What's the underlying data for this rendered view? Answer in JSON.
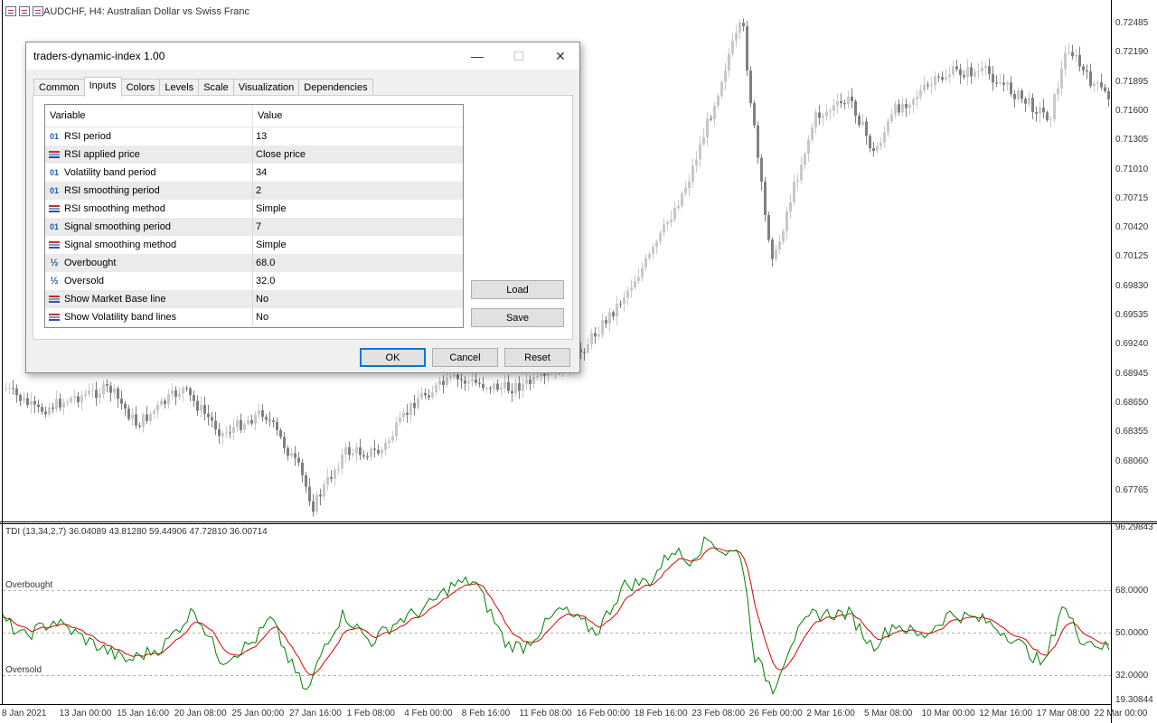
{
  "chart": {
    "title": "AUDCHF, H4:  Australian Dollar vs Swiss  Franc",
    "price_scale": [
      "0.72485",
      "0.72190",
      "0.71895",
      "0.71600",
      "0.71305",
      "0.71010",
      "0.70715",
      "0.70420",
      "0.70125",
      "0.69830",
      "0.69535",
      "0.69240",
      "0.68945",
      "0.68650",
      "0.68355",
      "0.68060",
      "0.67765"
    ],
    "indicator_scale": [
      "96.29843",
      "68.0000",
      "50.0000",
      "32.0000",
      "19.30844"
    ],
    "time_scale": [
      "8 Jan 2021",
      "13 Jan 00:00",
      "15 Jan 16:00",
      "20 Jan 08:00",
      "25 Jan 00:00",
      "27 Jan 16:00",
      "1 Feb 08:00",
      "4 Feb 00:00",
      "8 Feb 16:00",
      "11 Feb 08:00",
      "16 Feb 00:00",
      "18 Feb 16:00",
      "23 Feb 08:00",
      "26 Feb 00:00",
      "2 Mar 16:00",
      "5 Mar 08:00",
      "10 Mar 00:00",
      "12 Mar 16:00",
      "17 Mar 08:00",
      "22 Mar 00:00"
    ],
    "indicator_title": "TDI (13,34,2,7) 36.04089 43.81280 59.44906 47.72810 36.00714",
    "overbought_label": "Overbought",
    "oversold_label": "Oversold",
    "colors": {
      "fast_line": "#008000",
      "slow_line": "#e00000",
      "bull_candle": "#c8c8c8",
      "bear_candle": "#808080"
    }
  },
  "dialog": {
    "title": "traders-dynamic-index 1.00",
    "window_buttons": {
      "minimize": "—",
      "maximize": "☐",
      "close": "✕"
    },
    "tabs": [
      "Common",
      "Inputs",
      "Colors",
      "Levels",
      "Scale",
      "Visualization",
      "Dependencies"
    ],
    "active_tab": "Inputs",
    "grid": {
      "headers": [
        "Variable",
        "Value"
      ],
      "rows": [
        {
          "icon": "integer-icon",
          "icon_text": "01",
          "name": "RSI period",
          "value": "13"
        },
        {
          "icon": "enum-icon",
          "icon_text": "",
          "name": "RSI applied price",
          "value": "Close price"
        },
        {
          "icon": "integer-icon",
          "icon_text": "01",
          "name": "Volatility band period",
          "value": "34"
        },
        {
          "icon": "integer-icon",
          "icon_text": "01",
          "name": "RSI smoothing period",
          "value": "2"
        },
        {
          "icon": "enum-icon",
          "icon_text": "",
          "name": "RSI smoothing method",
          "value": "Simple"
        },
        {
          "icon": "integer-icon",
          "icon_text": "01",
          "name": "Signal smoothing period",
          "value": "7"
        },
        {
          "icon": "enum-icon",
          "icon_text": "",
          "name": "Signal smoothing method",
          "value": "Simple"
        },
        {
          "icon": "double-icon",
          "icon_text": "½",
          "name": "Overbought",
          "value": "68.0"
        },
        {
          "icon": "double-icon",
          "icon_text": "½",
          "name": "Oversold",
          "value": "32.0"
        },
        {
          "icon": "enum-icon",
          "icon_text": "",
          "name": "Show Market Base line",
          "value": "No"
        },
        {
          "icon": "enum-icon",
          "icon_text": "",
          "name": "Show Volatility band lines",
          "value": "No"
        }
      ]
    },
    "buttons": {
      "load": "Load",
      "save": "Save",
      "ok": "OK",
      "cancel": "Cancel",
      "reset": "Reset"
    }
  }
}
